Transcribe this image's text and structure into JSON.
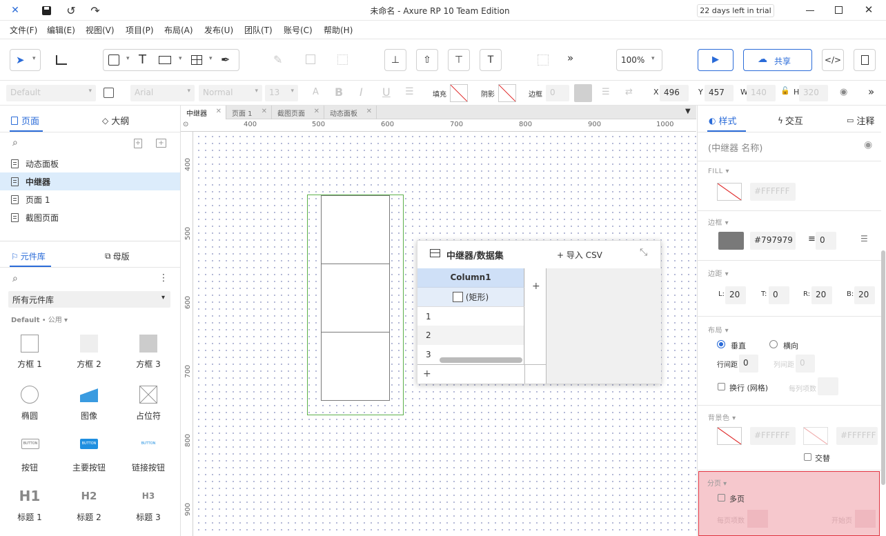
{
  "window": {
    "title": "未命名 - Axure RP 10 Team Edition",
    "trial": "22 days left in trial"
  },
  "menu": [
    "文件(F)",
    "编辑(E)",
    "视图(V)",
    "项目(P)",
    "布局(A)",
    "发布(U)",
    "团队(T)",
    "账号(C)",
    "帮助(H)"
  ],
  "toolbar": {
    "zoom": "100%",
    "share": "共享"
  },
  "format": {
    "style": "Default",
    "font": "Arial",
    "weight": "Normal",
    "size": "13",
    "fill_label": "填充",
    "shadow_label": "阴影",
    "border_label": "边框",
    "border_value": "0",
    "x_label": "X",
    "x": "496",
    "y_label": "Y",
    "y": "457",
    "w_label": "W",
    "w": "140",
    "h_label": "H",
    "h": "320"
  },
  "left": {
    "tabs": {
      "pages": "页面",
      "outline": "大纲"
    },
    "pages": [
      "动态面板",
      "中继器",
      "页面 1",
      "截图页面"
    ],
    "lib_tabs": {
      "library": "元件库",
      "masters": "母版"
    },
    "library_select": "所有元件库",
    "library_group": "Default",
    "library_sub": "公用",
    "widgets": [
      {
        "label": "方框 1"
      },
      {
        "label": "方框 2"
      },
      {
        "label": "方框 3"
      },
      {
        "label": "椭圆"
      },
      {
        "label": "图像"
      },
      {
        "label": "占位符"
      },
      {
        "label": "按钮",
        "inner": "BUTTON"
      },
      {
        "label": "主要按钮",
        "inner": "BUTTON"
      },
      {
        "label": "链接按钮",
        "inner": "BUTTON"
      },
      {
        "label": "标题 1",
        "inner": "H1"
      },
      {
        "label": "标题 2",
        "inner": "H2"
      },
      {
        "label": "标题 3",
        "inner": "H3"
      }
    ]
  },
  "canvas": {
    "tabs": [
      "中继器",
      "页面 1",
      "截图页面",
      "动态面板"
    ],
    "hruler": [
      "400",
      "500",
      "600",
      "700",
      "800",
      "900",
      "1000"
    ],
    "vruler": [
      "400",
      "500",
      "600",
      "700",
      "800",
      "900"
    ]
  },
  "repeater": {
    "title": "中继器/数据集",
    "import": "导入 CSV",
    "column": "Column1",
    "cell_type": "(矩形)",
    "rows": [
      "1",
      "2",
      "3"
    ],
    "add": "+"
  },
  "right": {
    "tabs": {
      "style": "样式",
      "interact": "交互",
      "notes": "注释"
    },
    "name_placeholder": "(中继器 名称)",
    "fill": {
      "label": "FILL",
      "value": "#FFFFFF"
    },
    "border": {
      "label": "边框",
      "color": "#797979",
      "width": "0"
    },
    "padding": {
      "label": "边距",
      "l_label": "L:",
      "l": "20",
      "t_label": "T:",
      "t": "0",
      "r_label": "R:",
      "r": "20",
      "b_label": "B:",
      "b": "20"
    },
    "layout": {
      "label": "布局",
      "vertical": "垂直",
      "horizontal": "横向",
      "row_gap": "行间距",
      "row_gap_value": "0",
      "col_gap": "列间距",
      "col_gap_value": "0",
      "wrap": "换行 (网格)",
      "per_row": "每列项数"
    },
    "bg": {
      "label": "背景色",
      "c1": "#FFFFFF",
      "c2": "#FFFFFF",
      "alt": "交替"
    },
    "paging": {
      "label": "分页",
      "multi": "多页",
      "per_page": "每页项数",
      "start": "开始页"
    }
  }
}
